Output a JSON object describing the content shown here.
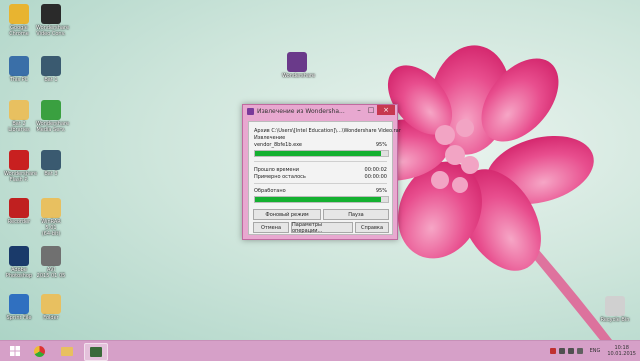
{
  "desktop": {
    "icons": [
      {
        "label": "Google\nChrome",
        "icon": "chrome-icon",
        "color": "#e8b430"
      },
      {
        "label": "Wondershare\nVideo Conv.",
        "icon": "wondershare-icon",
        "color": "#2a2a2a"
      },
      {
        "label": "This PC",
        "icon": "computer-icon",
        "color": "#3a6fa8"
      },
      {
        "label": "Bat 1",
        "icon": "monitor-icon",
        "color": "#3a5a70"
      },
      {
        "label": "Bat 2\nLibraries",
        "icon": "folder-icon",
        "color": "#e8c060"
      },
      {
        "label": "Wondershare\nMedia Serv.",
        "icon": "media-server-icon",
        "color": "#3aa040"
      },
      {
        "label": "Wondershare\nFlash P.",
        "icon": "flash-icon",
        "color": "#c82020"
      },
      {
        "label": "Bat 3",
        "icon": "monitor-icon",
        "color": "#3a5a70"
      },
      {
        "label": "Recorder",
        "icon": "recorder-icon",
        "color": "#c02020"
      },
      {
        "label": "WinRAR 5.01\n(64-bit)",
        "icon": "folder-icon",
        "color": "#e8c060"
      },
      {
        "label": "Adobe\nPhotoshop",
        "icon": "photoshop-icon",
        "color": "#1a3a6a"
      },
      {
        "label": "AVI\n2015 01 05",
        "icon": "video-file-icon",
        "color": "#707070"
      },
      {
        "label": "Sprint File",
        "icon": "paint-icon",
        "color": "#3070c0"
      },
      {
        "label": "Folder",
        "icon": "folder-icon",
        "color": "#e8c060"
      },
      {
        "label": "Wondershare",
        "icon": "winrar-icon",
        "color": "#6a3a8a"
      },
      {
        "label": "Recycle Bin",
        "icon": "recycle-bin-icon",
        "color": "#d0d0d0"
      }
    ]
  },
  "dialog": {
    "title": "Извлечение из Wondersha...",
    "archive_line": "Архив C:\\Users\\[Intel Education]\\...\\Wondershare Video.rar",
    "extracting_label": "Извлечение",
    "file_name": "vendor_8bfe1b.exe",
    "file_percent": "95%",
    "file_progress": 0.95,
    "elapsed_label": "Прошло времени",
    "elapsed_value": "00:00:02",
    "remaining_label": "Примерно осталось",
    "remaining_value": "00:00:00",
    "processed_label": "Обработано",
    "processed_percent": "95%",
    "processed_progress": 0.95,
    "buttons": {
      "background": "Фоновый режим",
      "pause": "Пауза",
      "cancel": "Отмена",
      "options": "Параметры операции...",
      "help": "Справка"
    },
    "win_minimize": "–",
    "win_maximize": "□",
    "win_close": "×"
  },
  "taskbar": {
    "start_icon": "windows-start-icon",
    "apps": [
      {
        "name": "chrome-taskbar-button",
        "icon": "chrome-icon",
        "color": "#e8b430"
      },
      {
        "name": "explorer-taskbar-button",
        "icon": "folder-icon",
        "color": "#e8c060"
      },
      {
        "name": "winrar-taskbar-button",
        "icon": "winrar-icon",
        "color": "#3a6a3a"
      }
    ],
    "language": "ENG",
    "time": "10:18",
    "date": "10.01.2015"
  },
  "colors": {
    "taskbar": "#d6a0c8",
    "dialog_frame": "#e8a8d0",
    "progress": "#14b030",
    "flower": "#e0307a"
  }
}
